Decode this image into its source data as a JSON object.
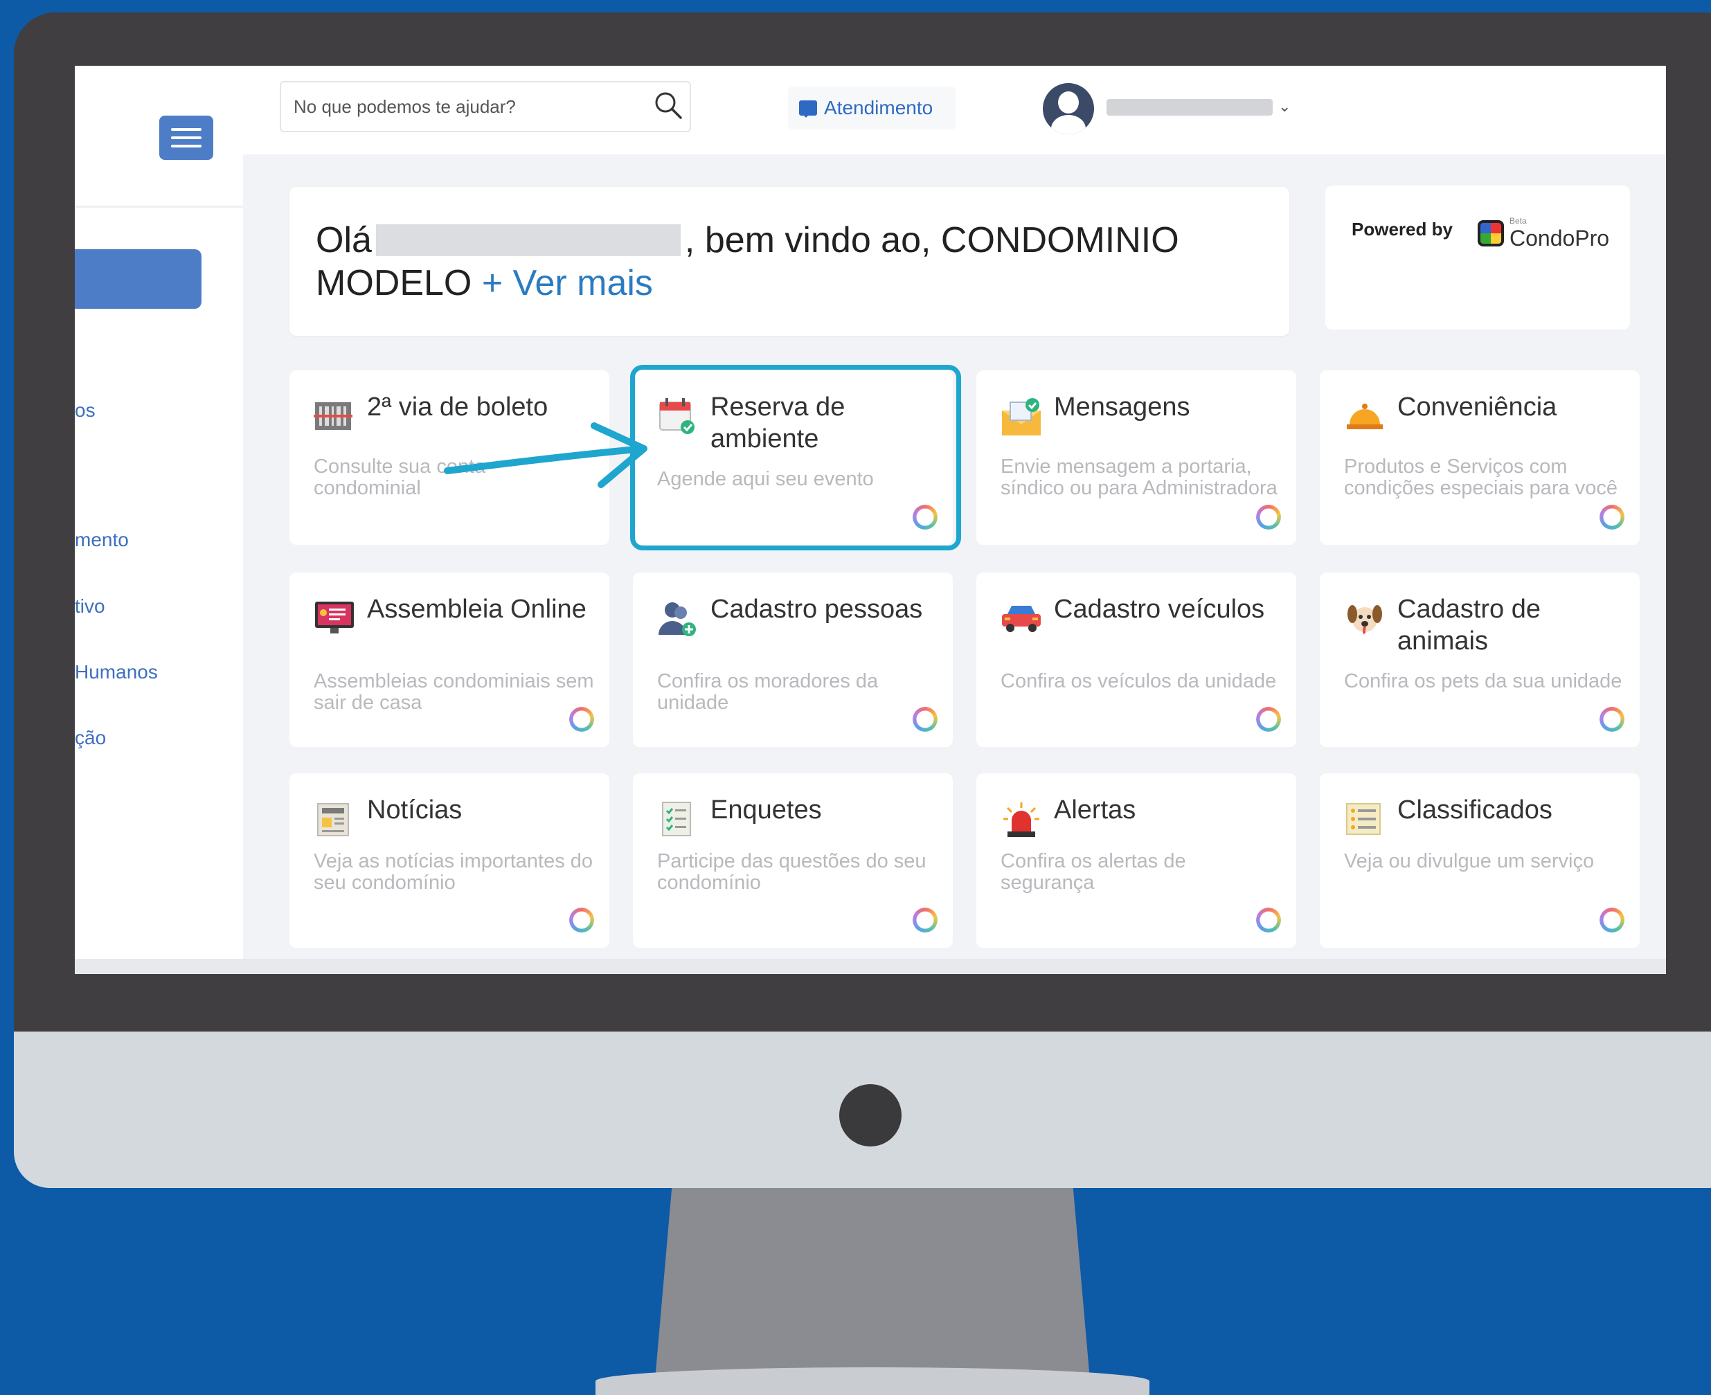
{
  "search": {
    "placeholder": "No que podemos te ajudar?"
  },
  "header": {
    "atendimento_label": "Atendimento"
  },
  "welcome": {
    "greeting": "Olá",
    "message": ", bem vindo ao, CONDOMINIO MODELO",
    "more_link": "+ Ver mais"
  },
  "powered": {
    "label": "Powered by",
    "brand_beta": "Beta",
    "brand_name": "CondoPro"
  },
  "sidebar": {
    "items": [
      {
        "label": "os"
      },
      {
        "label": "mento"
      },
      {
        "label": "tivo"
      },
      {
        "label": "Humanos"
      },
      {
        "label": "ção"
      }
    ]
  },
  "cards": [
    {
      "title": "2ª via de boleto",
      "desc": "Consulte sua conta condominial",
      "icon": "barcode-icon"
    },
    {
      "title": "Reserva de ambiente",
      "desc": "Agende aqui seu evento",
      "icon": "calendar-check-icon"
    },
    {
      "title": "Mensagens",
      "desc": "Envie mensagem a portaria, síndico ou para Administradora",
      "icon": "envelope-icon"
    },
    {
      "title": "Conveniência",
      "desc": "Produtos e Serviços com condições especiais para você",
      "icon": "service-bell-icon"
    },
    {
      "title": "Assembleia Online",
      "desc": "Assembleias condominiais sem sair de casa",
      "icon": "monitor-icon"
    },
    {
      "title": "Cadastro pessoas",
      "desc": "Confira os moradores da unidade",
      "icon": "people-add-icon"
    },
    {
      "title": "Cadastro veículos",
      "desc": "Confira os veículos da unidade",
      "icon": "car-icon"
    },
    {
      "title": "Cadastro de animais",
      "desc": "Confira os pets da sua unidade",
      "icon": "dog-icon"
    },
    {
      "title": "Notícias",
      "desc": "Veja as notícias importantes do seu condomínio",
      "icon": "newspaper-icon"
    },
    {
      "title": "Enquetes",
      "desc": "Participe das questões do seu condomínio",
      "icon": "checklist-icon"
    },
    {
      "title": "Alertas",
      "desc": "Confira os alertas de segurança",
      "icon": "siren-icon"
    },
    {
      "title": "Classificados",
      "desc": "Veja ou divulgue um serviço",
      "icon": "list-icon"
    }
  ],
  "colors": {
    "background": "#0d5aa7",
    "accent": "#4d7dc6",
    "highlight": "#1ea6cf",
    "link": "#2b7bc0"
  }
}
